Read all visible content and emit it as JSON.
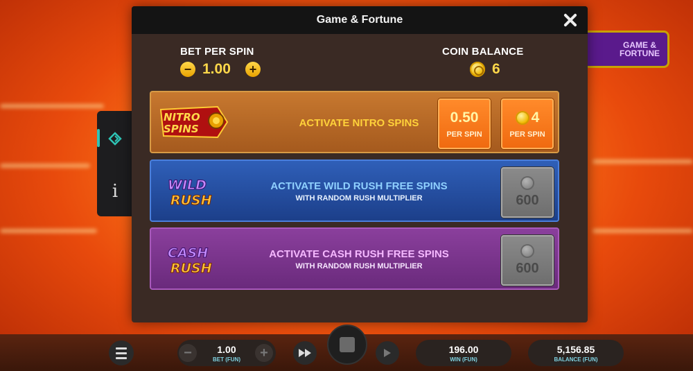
{
  "modal": {
    "title": "Game & Fortune",
    "bet_per_spin_label": "BET PER SPIN",
    "bet_value": "1.00",
    "bet_minus": "−",
    "bet_plus": "+",
    "coin_balance_label": "COIN BALANCE",
    "coin_balance_value": "6"
  },
  "background": {
    "game_fortune_button": "GAME & FORTUNE"
  },
  "side_tabs": {
    "info_glyph": "i"
  },
  "features": [
    {
      "logo_text": [
        "NITRO",
        "SPINS"
      ],
      "title": "ACTIVATE NITRO SPINS",
      "price_cash": "0.50",
      "price_cash_sub": "PER SPIN",
      "price_coins": "4",
      "price_coins_sub": "PER SPIN"
    },
    {
      "logo_text": [
        "WILD",
        "RUSH"
      ],
      "title": "ACTIVATE WILD RUSH FREE SPINS",
      "subtitle": "WITH RANDOM RUSH MULTIPLIER",
      "price_coins": "600"
    },
    {
      "logo_text": [
        "CASH",
        "RUSH"
      ],
      "title": "ACTIVATE CASH RUSH FREE SPINS",
      "subtitle": "WITH RANDOM RUSH MULTIPLIER",
      "price_coins": "600"
    }
  ],
  "bottom_bar": {
    "bet_value": "1.00",
    "bet_label": "BET (FUN)",
    "minus": "−",
    "plus": "+",
    "win_value": "196.00",
    "win_label": "WIN (FUN)",
    "balance_value": "5,156.85",
    "balance_label": "BALANCE (FUN)"
  },
  "colors": {
    "accent_gold": "#ffd84a",
    "nitro_row": "#b5682a",
    "wild_row": "#2a52a8",
    "cash_row": "#7a3490",
    "price_orange": "#f57a1c",
    "tab_active": "#2ec4b6"
  }
}
